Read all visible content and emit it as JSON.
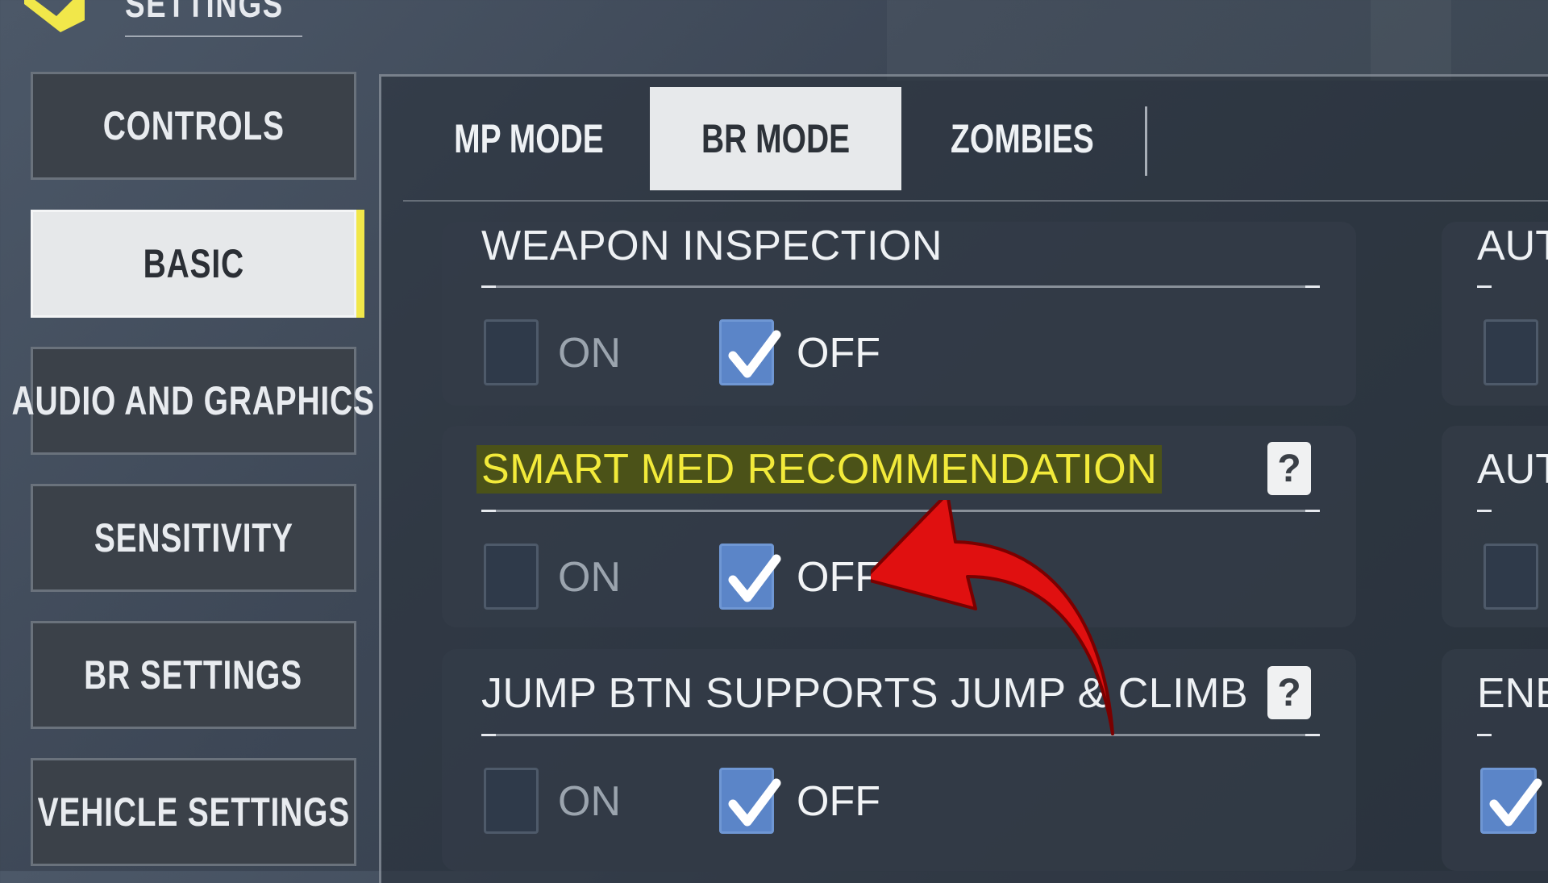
{
  "header": {
    "title": "SETTINGS"
  },
  "sidebar": {
    "items": [
      {
        "label": "CONTROLS",
        "active": false
      },
      {
        "label": "BASIC",
        "active": true
      },
      {
        "label": "AUDIO AND GRAPHICS",
        "active": false
      },
      {
        "label": "SENSITIVITY",
        "active": false
      },
      {
        "label": "BR SETTINGS",
        "active": false
      },
      {
        "label": "VEHICLE SETTINGS",
        "active": false
      }
    ]
  },
  "tabs": [
    {
      "label": "MP MODE",
      "active": false
    },
    {
      "label": "BR MODE",
      "active": true
    },
    {
      "label": "ZOMBIES",
      "active": false
    }
  ],
  "settings": [
    {
      "label": "WEAPON INSPECTION",
      "on_label": "ON",
      "off_label": "OFF",
      "selected": "OFF",
      "has_help": false,
      "highlighted": false
    },
    {
      "label": "SMART MED RECOMMENDATION",
      "on_label": "ON",
      "off_label": "OFF",
      "selected": "OFF",
      "has_help": true,
      "highlighted": true,
      "help_label": "?"
    },
    {
      "label": "JUMP BTN SUPPORTS JUMP & CLIMB",
      "on_label": "ON",
      "off_label": "OFF",
      "selected": "OFF",
      "has_help": true,
      "highlighted": false,
      "help_label": "?"
    }
  ],
  "right_column": {
    "labels": [
      "AUT",
      "AUT",
      "ENE"
    ]
  },
  "colors": {
    "accent": "#f1e74a",
    "checkbox_checked": "#5b85c8",
    "arrow": "#e01010"
  }
}
